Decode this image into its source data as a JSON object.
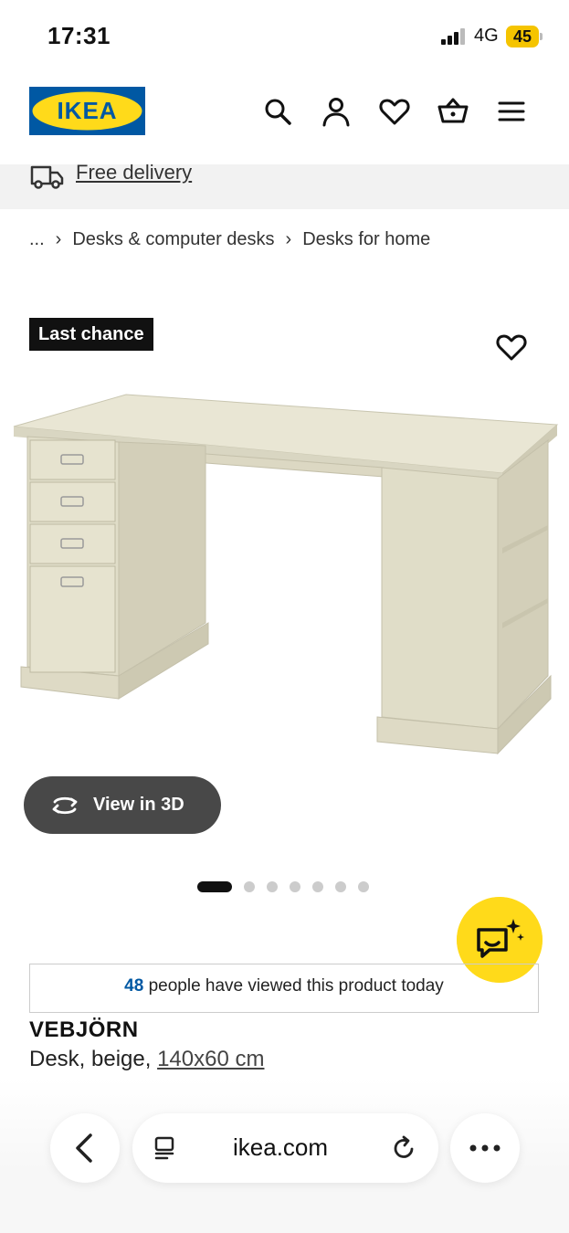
{
  "status_bar": {
    "time": "17:31",
    "network": "4G",
    "battery": "45"
  },
  "header": {
    "logo_text": "IKEA",
    "icons": [
      "search-icon",
      "account-icon",
      "favourites-icon",
      "basket-icon",
      "menu-icon"
    ],
    "brand_blue": "#0058a3",
    "brand_yellow": "#ffda1a"
  },
  "delivery": {
    "label": "Free delivery"
  },
  "breadcrumb": {
    "items": [
      "...",
      "Desks & computer desks",
      "Desks for home"
    ]
  },
  "product": {
    "badge": "Last chance",
    "view_3d_label": "View in 3D",
    "gallery": {
      "total_images": 7,
      "active_index": 0
    },
    "viewed_count": "48",
    "viewed_text": "people have viewed this product today",
    "name": "VEBJÖRN",
    "description": "Desk, beige,",
    "size": "140x60 cm"
  },
  "browser": {
    "url": "ikea.com"
  }
}
